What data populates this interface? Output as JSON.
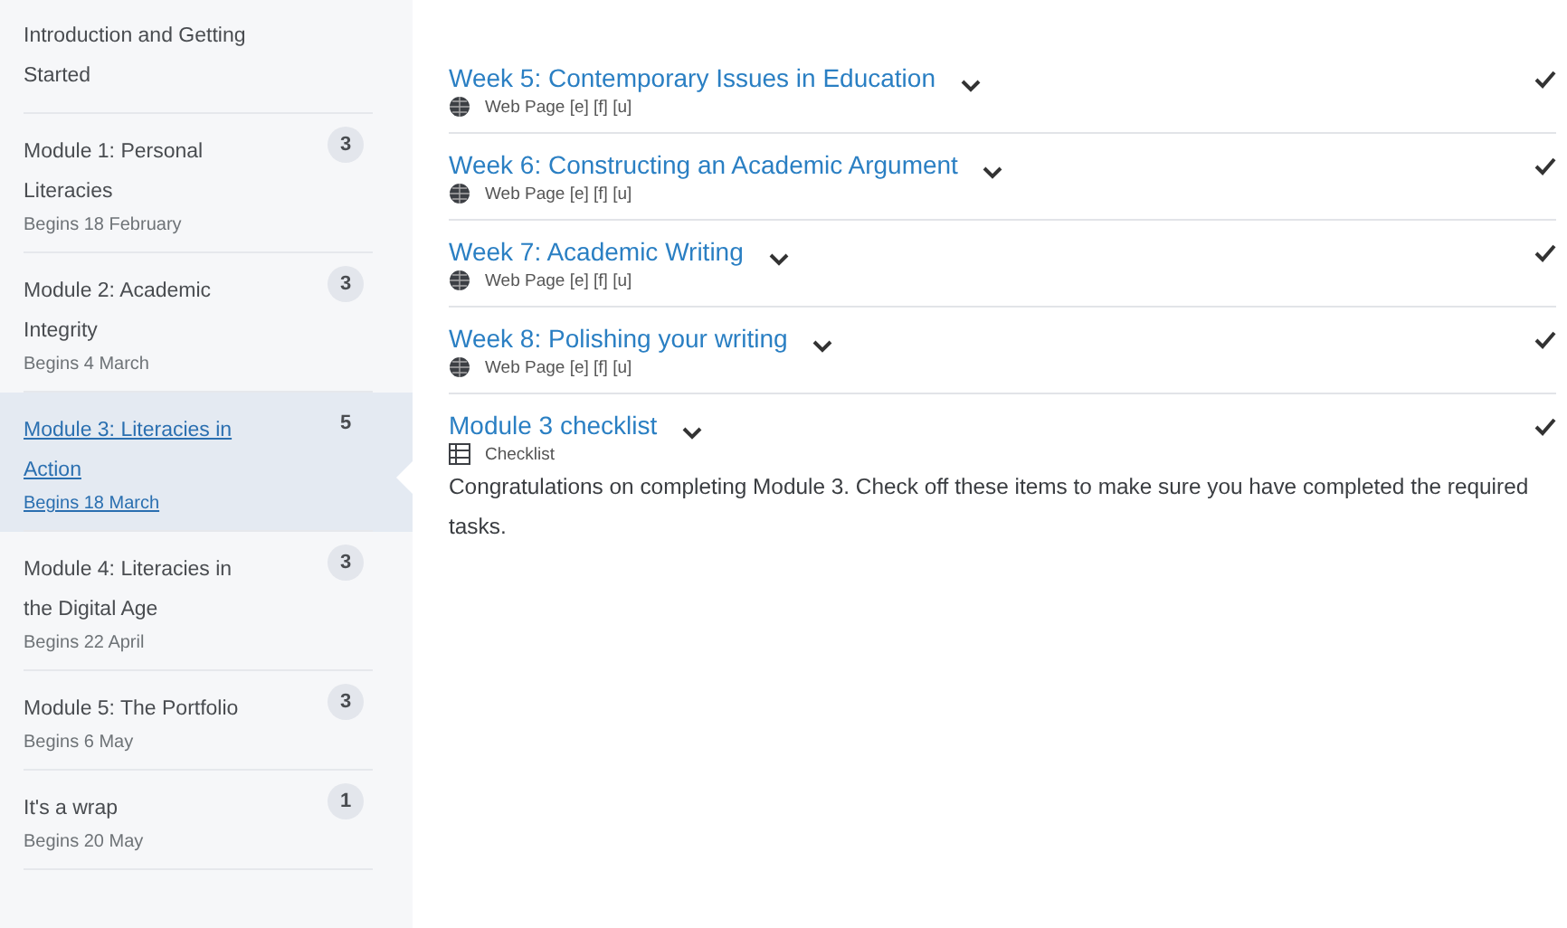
{
  "sidebar": {
    "items": [
      {
        "title": "Introduction and Getting Started",
        "selected": false
      },
      {
        "title": "Module 1: Personal Literacies",
        "date": "Begins 18 February",
        "count": "3",
        "selected": false
      },
      {
        "title": "Module 2: Academic Integrity",
        "date": "Begins 4 March",
        "count": "3",
        "selected": false
      },
      {
        "title": "Module 3: Literacies in Action",
        "date": "Begins 18 March",
        "count": "5",
        "selected": true
      },
      {
        "title": "Module 4: Literacies in the Digital Age",
        "date": "Begins 22 April",
        "count": "3",
        "selected": false
      },
      {
        "title": "Module 5: The Portfolio",
        "date": "Begins 6 May",
        "count": "3",
        "selected": false
      },
      {
        "title": "It's a wrap",
        "date": "Begins 20 May",
        "count": "1",
        "selected": false
      }
    ]
  },
  "topics": [
    {
      "title": "Week 5: Contemporary Issues in Education",
      "kind": "webpage",
      "type": "Web Page [e] [f] [u]",
      "completed": true
    },
    {
      "title": "Week 6: Constructing an Academic Argument",
      "kind": "webpage",
      "type": "Web Page [e] [f] [u]",
      "completed": true
    },
    {
      "title": "Week 7: Academic Writing",
      "kind": "webpage",
      "type": "Web Page [e] [f] [u]",
      "completed": true
    },
    {
      "title": "Week 8: Polishing your writing",
      "kind": "webpage",
      "type": "Web Page [e] [f] [u]",
      "completed": true
    },
    {
      "title": "Module 3 checklist",
      "kind": "checklist",
      "type": "Checklist",
      "completed": true,
      "description": "Congratulations on completing Module 3. Check off these items to make sure you have completed the required tasks."
    }
  ]
}
